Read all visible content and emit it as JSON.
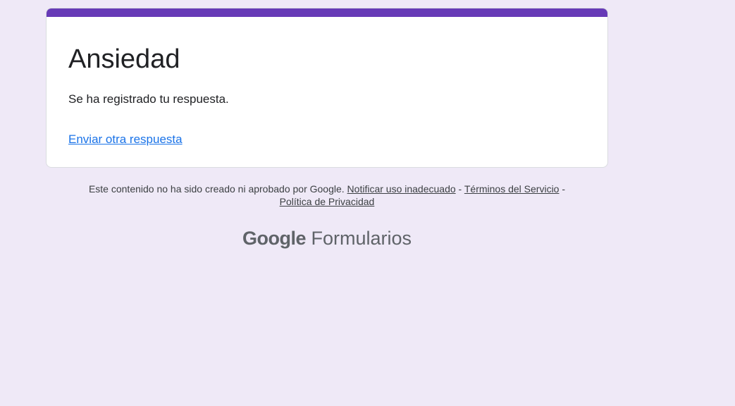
{
  "form": {
    "title": "Ansiedad",
    "confirmation": "Se ha registrado tu respuesta.",
    "submit_another": "Enviar otra respuesta",
    "accent_color": "#673ab7",
    "background_color": "#efe9f7"
  },
  "footer": {
    "disclaimer": "Este contenido no ha sido creado ni aprobado por Google.",
    "report_abuse": "Notificar uso inadecuado",
    "sep1": " - ",
    "terms": "Términos del Servicio",
    "sep2": " - ",
    "privacy": "Política de Privacidad"
  },
  "brand": {
    "google": "Google",
    "product": "Formularios"
  }
}
